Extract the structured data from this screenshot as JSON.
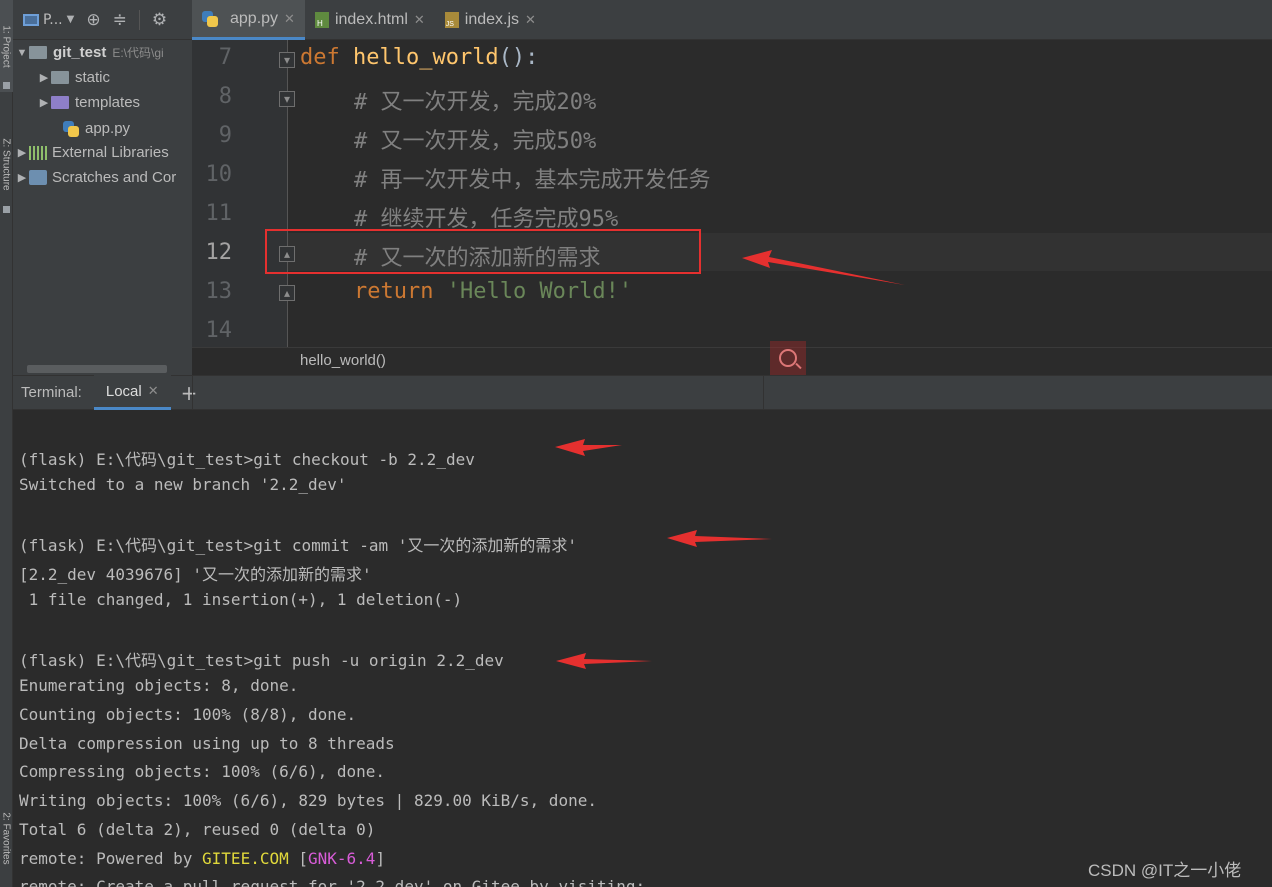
{
  "side_tabs": {
    "project": "1: Project",
    "structure": "Z: Structure",
    "favorites": "2: Favorites"
  },
  "project_toolbar": {
    "selector": "P..."
  },
  "project_tree": {
    "root": {
      "name": "git_test",
      "path": "E:\\代码\\gi"
    },
    "items": [
      {
        "label": "static",
        "icon": "folder-icon"
      },
      {
        "label": "templates",
        "icon": "folder-icon"
      },
      {
        "label": "app.py",
        "icon": "python-file-icon"
      },
      {
        "label": "External Libraries",
        "icon": "library-icon"
      },
      {
        "label": "Scratches and Cor",
        "icon": "scratches-icon"
      }
    ]
  },
  "tabs": [
    {
      "label": "app.py",
      "active": true
    },
    {
      "label": "index.html",
      "active": false
    },
    {
      "label": "index.js",
      "active": false
    }
  ],
  "editor": {
    "lines": [
      {
        "no": "7",
        "def": "def ",
        "fn": "hello_world",
        "rest": "():"
      },
      {
        "no": "8",
        "comment": "# 又一次开发，完成20%"
      },
      {
        "no": "9",
        "comment": "# 又一次开发，完成50%"
      },
      {
        "no": "10",
        "comment": "# 再一次开发中，基本完成开发任务"
      },
      {
        "no": "11",
        "comment": "# 继续开发，任务完成95%"
      },
      {
        "no": "12",
        "comment": "# 又一次的添加新的需求"
      },
      {
        "no": "13",
        "kw": "return ",
        "str": "'Hello World!'"
      },
      {
        "no": "14"
      }
    ],
    "breadcrumb": "hello_world()"
  },
  "terminal": {
    "label": "Terminal:",
    "tab": "Local",
    "lines": [
      "(flask) E:\\代码\\git_test>git checkout -b 2.2_dev",
      "Switched to a new branch '2.2_dev'",
      "(flask) E:\\代码\\git_test>git commit -am '又一次的添加新的需求'",
      "[2.2_dev 4039676] '又一次的添加新的需求'",
      " 1 file changed, 1 insertion(+), 1 deletion(-)",
      "(flask) E:\\代码\\git_test>git push -u origin 2.2_dev",
      "Enumerating objects: 8, done.",
      "Counting objects: 100% (8/8), done.",
      "Delta compression using up to 8 threads",
      "Compressing objects: 100% (6/6), done.",
      "Writing objects: 100% (6/6), 829 bytes | 829.00 KiB/s, done.",
      "Total 6 (delta 2), reused 0 (delta 0)",
      "remote: Create a pull request for '2.2_dev' on Gitee by visiting:"
    ],
    "powered": {
      "prefix": "remote: Powered by ",
      "site": "GITEE.COM",
      "open": " [",
      "version": "GNK-6.4",
      "close": "]"
    }
  },
  "watermark": "CSDN @IT之一小佬",
  "colors": {
    "keyword": "#cc7832",
    "function": "#ffc66d",
    "comment": "#808080",
    "string": "#6a8759",
    "annotation": "#e5302f"
  }
}
